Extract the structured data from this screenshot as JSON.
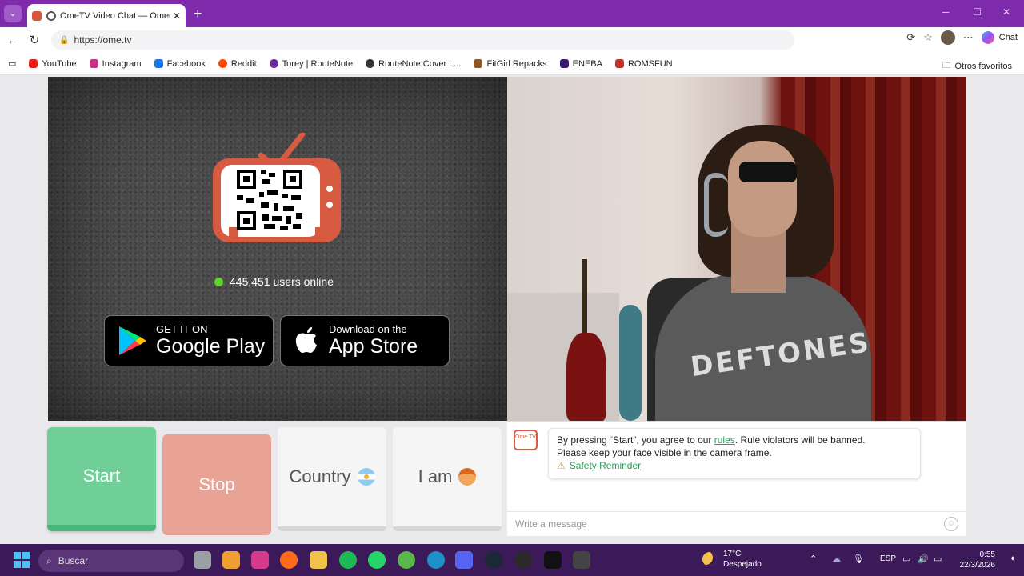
{
  "browser": {
    "tab": {
      "title": "OmeTV Video Chat — Omegl",
      "close": "✕"
    },
    "new_tab": "+",
    "window_controls": {
      "minimize": "─",
      "maximize": "☐",
      "close": "✕"
    },
    "url": "https://ome.tv",
    "chat_label": "Chat",
    "bookmarks": [
      {
        "label": "YouTube",
        "color": "#e62117"
      },
      {
        "label": "Instagram",
        "color": "#c13584"
      },
      {
        "label": "Facebook",
        "color": "#1877f2"
      },
      {
        "label": "Reddit",
        "color": "#ff4500"
      },
      {
        "label": "Torey | RouteNote",
        "color": "#6a2a9a"
      },
      {
        "label": "RouteNote Cover L...",
        "color": "#333333"
      },
      {
        "label": "FitGirl Repacks",
        "color": "#8a5a2a"
      },
      {
        "label": "ENEBA",
        "color": "#3a1a6a"
      },
      {
        "label": "ROMSFUN",
        "color": "#c0302a"
      }
    ],
    "other_favorites": "Otros favoritos"
  },
  "main": {
    "online_count": "445,451 users online",
    "google_play": {
      "small": "GET IT ON",
      "big": "Google Play"
    },
    "app_store": {
      "small": "Download on the",
      "big": "App Store"
    },
    "shirt_text": "DEFTONES"
  },
  "controls": {
    "start": "Start",
    "stop": "Stop",
    "country": "Country",
    "iam": "I am"
  },
  "chat": {
    "logo_text": "Ome TV",
    "notice_prefix": "By pressing “Start”, you agree to our ",
    "rules_link": "rules",
    "notice_suffix": ". Rule violators will be banned.",
    "notice_line2": "Please keep your face visible in the camera frame.",
    "safety_link": "Safety Reminder",
    "placeholder": "Write a message"
  },
  "taskbar": {
    "search": "Buscar",
    "temp": "17°C",
    "weather": "Despejado",
    "lang": "ESP",
    "time": "0:55",
    "date": "22/3/2026"
  },
  "colors": {
    "accent": "#7d2bab",
    "start": "#6fcf97",
    "stop": "#e9a394",
    "brand": "#d65b41"
  }
}
